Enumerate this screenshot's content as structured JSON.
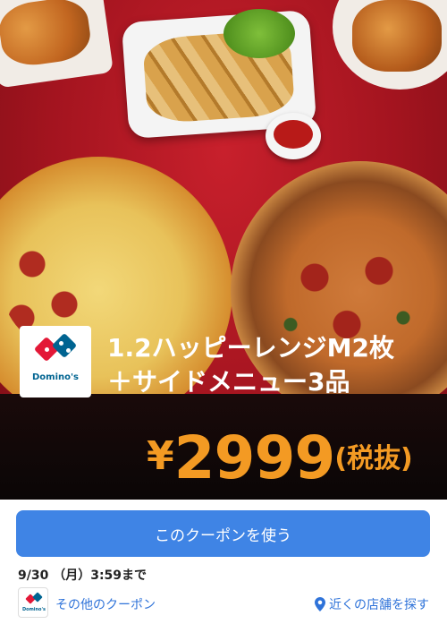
{
  "hero": {
    "brand_name": "Domino's",
    "title_line1": "1.2ハッピーレンジM2枚",
    "title_line2": "＋サイドメニュー3品",
    "price_symbol": "¥",
    "price_amount": "2999",
    "price_note": "(税抜)"
  },
  "coupon": {
    "use_button_label": "このクーポンを使う",
    "deadline": "9/30 （月）3:59まで"
  },
  "footer": {
    "brand_name": "Domino's",
    "other_coupons_label": "その他のクーポン",
    "nearby_stores_label": "近くの店舗を探す"
  },
  "colors": {
    "hero_red": "#a3141f",
    "price_orange": "#f39a23",
    "button_blue": "#3f84e5",
    "link_blue": "#2f73d9",
    "brand_red": "#e31837",
    "brand_blue": "#006491"
  },
  "icons": {
    "location": "map-pin-icon",
    "logo": "dominos-logo-icon"
  }
}
